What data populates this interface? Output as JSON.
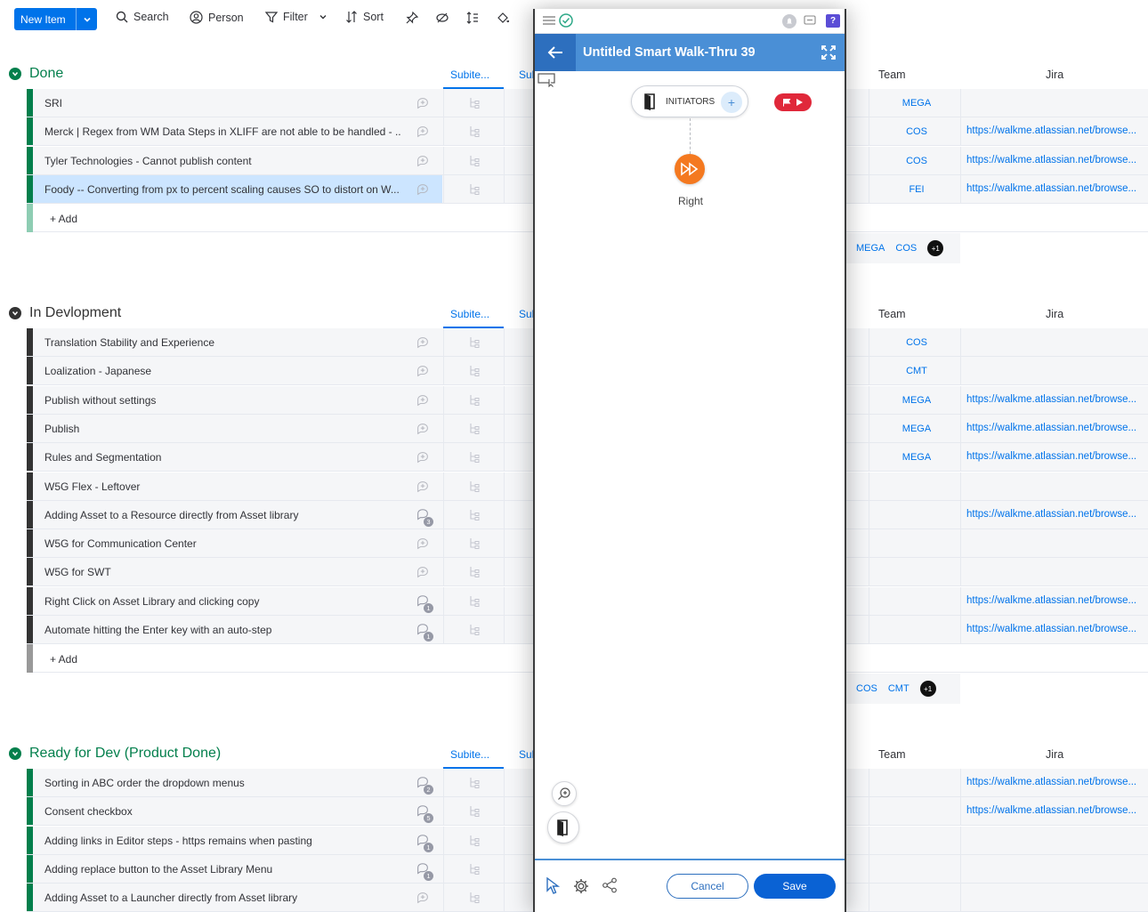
{
  "toolbar": {
    "new_item": "New Item",
    "search": "Search",
    "person": "Person",
    "filter": "Filter",
    "sort": "Sort"
  },
  "columns": {
    "subitems": "Subite...",
    "subitems2": "Sul",
    "team": "Team",
    "jira": "Jira"
  },
  "colors": {
    "accent": "#0073ea",
    "done_group": "#037f4c",
    "dev_group": "#333333",
    "ready_group": "#037f4c",
    "walkme_blue": "#4a8fd6",
    "step_orange": "#f47920"
  },
  "groups": [
    {
      "title": "Done",
      "rows": [
        {
          "name": "SRI",
          "team": "MEGA",
          "jira": ""
        },
        {
          "name": "Merck | Regex from WM Data Steps in XLIFF are not able to be handled - ...",
          "team": "COS",
          "jira": "https://walkme.atlassian.net/browse..."
        },
        {
          "name": "Tyler Technologies - Cannot publish content",
          "team": "COS",
          "jira": "https://walkme.atlassian.net/browse..."
        },
        {
          "name": "Foody -- Converting from px to percent scaling causes SO to distort on W...",
          "team": "FEI",
          "jira": "https://walkme.atlassian.net/browse..."
        }
      ],
      "add": "+ Add",
      "summary": {
        "tags": [
          "MEGA",
          "COS"
        ],
        "more": "+1"
      }
    },
    {
      "title": "In Devlopment",
      "rows": [
        {
          "name": "Translation Stability and Experience",
          "team": "COS",
          "jira": ""
        },
        {
          "name": "Loalization - Japanese",
          "team": "CMT",
          "jira": ""
        },
        {
          "name": "Publish without settings",
          "team": "MEGA",
          "jira": "https://walkme.atlassian.net/browse..."
        },
        {
          "name": "Publish",
          "team": "MEGA",
          "jira": "https://walkme.atlassian.net/browse..."
        },
        {
          "name": "Rules and Segmentation",
          "team": "MEGA",
          "jira": "https://walkme.atlassian.net/browse..."
        },
        {
          "name": "W5G Flex - Leftover",
          "team": "",
          "jira": ""
        },
        {
          "name": "Adding Asset to a Resource directly from Asset library",
          "team": "",
          "jira": "https://walkme.atlassian.net/browse...",
          "updates": "3"
        },
        {
          "name": "W5G for Communication Center",
          "team": "",
          "jira": ""
        },
        {
          "name": "W5G for SWT",
          "team": "",
          "jira": ""
        },
        {
          "name": "Right Click on Asset Library and clicking copy",
          "team": "",
          "jira": "https://walkme.atlassian.net/browse...",
          "updates": "1"
        },
        {
          "name": "Automate hitting the Enter key with an auto-step",
          "team": "",
          "jira": "https://walkme.atlassian.net/browse...",
          "updates": "1"
        }
      ],
      "add": "+ Add",
      "summary": {
        "tags": [
          "COS",
          "CMT"
        ],
        "more": "+1"
      }
    },
    {
      "title": "Ready for Dev (Product Done)",
      "rows": [
        {
          "name": "Sorting in ABC order the dropdown menus",
          "team": "",
          "jira": "https://walkme.atlassian.net/browse...",
          "updates": "2"
        },
        {
          "name": "Consent checkbox",
          "team": "",
          "jira": "https://walkme.atlassian.net/browse...",
          "updates": "5"
        },
        {
          "name": "Adding links in Editor steps - https remains when pasting",
          "team": "",
          "jira": "",
          "updates": "1"
        },
        {
          "name": "Adding replace button to the Asset Library Menu",
          "team": "",
          "jira": "",
          "updates": "1"
        },
        {
          "name": "Adding Asset to a Launcher directly from Asset library",
          "team": "",
          "jira": ""
        }
      ]
    }
  ],
  "panel": {
    "title": "Untitled Smart Walk-Thru 39",
    "initiators": "INITIATORS",
    "step_label": "Right",
    "cancel": "Cancel",
    "save": "Save",
    "top_badge": "?"
  }
}
